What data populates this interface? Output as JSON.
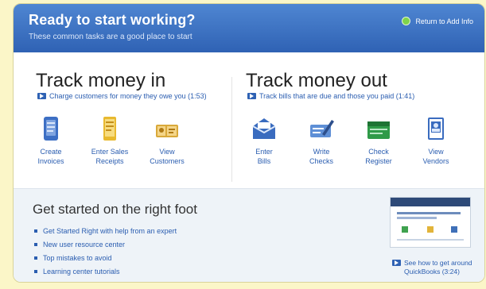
{
  "banner": {
    "title": "Ready to start working?",
    "subtitle": "These common tasks are a good place to start",
    "return_link": "Return to Add Info"
  },
  "money_in": {
    "title": "Track money in",
    "link": "Charge customers for money they owe you (1:53)",
    "tasks": [
      {
        "label": "Create\nInvoices",
        "icon": "invoice-icon"
      },
      {
        "label": "Enter Sales\nReceipts",
        "icon": "sales-receipt-icon"
      },
      {
        "label": "View\nCustomers",
        "icon": "customers-icon"
      }
    ]
  },
  "money_out": {
    "title": "Track money out",
    "link": "Track bills that are due and those you paid (1:41)",
    "tasks": [
      {
        "label": "Enter\nBills",
        "icon": "bills-icon"
      },
      {
        "label": "Write\nChecks",
        "icon": "write-checks-icon"
      },
      {
        "label": "Check\nRegister",
        "icon": "check-register-icon"
      },
      {
        "label": "View\nVendors",
        "icon": "vendors-icon"
      }
    ]
  },
  "get_started": {
    "title": "Get started on the right foot",
    "items": [
      "Get Started Right with help from an expert",
      "New user resource center",
      "Top mistakes to avoid",
      "Learning center tutorials"
    ],
    "video_link": "See how to get around QuickBooks (3:24)"
  },
  "colors": {
    "banner": "#2f62b4",
    "link": "#2a5db0",
    "background": "#fbf6c8"
  }
}
